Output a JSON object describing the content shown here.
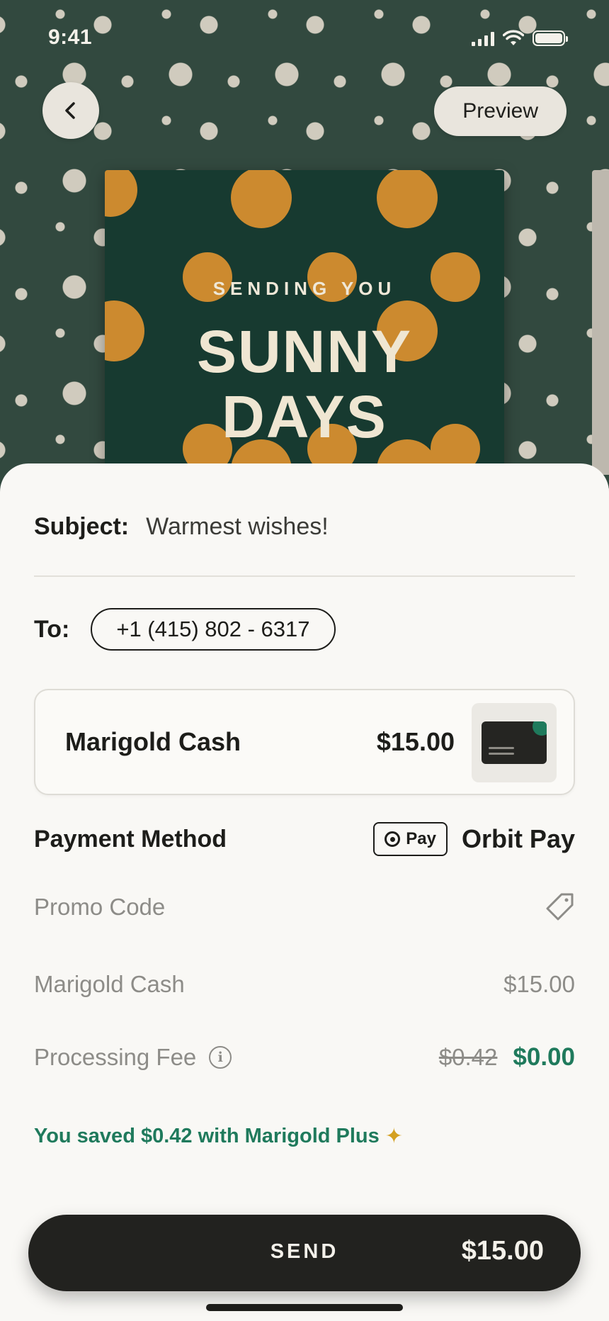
{
  "status_bar": {
    "time": "9:41"
  },
  "header": {
    "preview_label": "Preview"
  },
  "card": {
    "kicker": "SENDING YOU",
    "title_line1": "SUNNY",
    "title_line2": "DAYS"
  },
  "subject": {
    "label": "Subject:",
    "value": "Warmest wishes!"
  },
  "to": {
    "label": "To:",
    "value": "+1 (415) 802 - 6317"
  },
  "product": {
    "name": "Marigold Cash",
    "price": "$15.00"
  },
  "payment": {
    "label": "Payment Method",
    "badge_text": "Pay",
    "method": "Orbit Pay"
  },
  "promo": {
    "label": "Promo Code"
  },
  "summary": {
    "cash_label": "Marigold Cash",
    "cash_value": "$15.00",
    "fee_label": "Processing Fee",
    "fee_original": "$0.42",
    "fee_final": "$0.00"
  },
  "savings": {
    "text": "You saved $0.42 with Marigold Plus",
    "icon": "sparkle-icon"
  },
  "send": {
    "label": "SEND",
    "amount": "$15.00"
  },
  "colors": {
    "accent_green": "#1f7a5c",
    "card_green": "#173a30",
    "gold": "#cc8a2f",
    "dark_button": "#22221f"
  }
}
